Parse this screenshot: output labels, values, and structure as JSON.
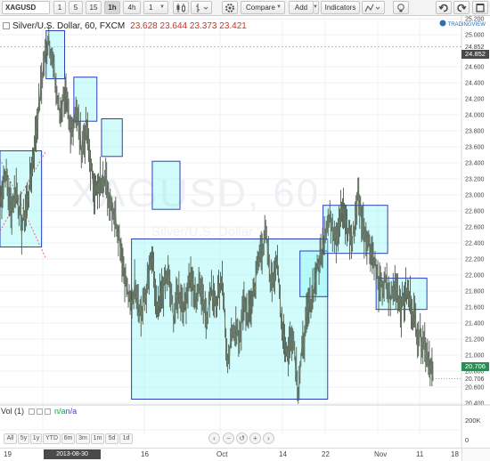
{
  "toolbar": {
    "symbol": "XAGUSD",
    "intervals": [
      "1",
      "5",
      "15",
      "1h",
      "4h",
      "1"
    ],
    "active_interval": "1h",
    "compare_label": "Compare",
    "add_label": "Add",
    "indicators_label": "Indicators"
  },
  "legend": {
    "title": "Silver/U.S. Dollar, 60, FXCM",
    "open": "23.628",
    "high": "23.644",
    "low": "23.373",
    "close": "23.421"
  },
  "watermark": {
    "symbol": "XAGUSD, 60",
    "name": "Silver/U.S. Dollar"
  },
  "price_axis": {
    "labels": [
      "25.200",
      "25.000",
      "24.852",
      "24.600",
      "24.400",
      "24.200",
      "24.000",
      "23.800",
      "23.600",
      "23.400",
      "23.200",
      "23.000",
      "22.800",
      "22.600",
      "22.400",
      "22.200",
      "22.000",
      "21.800",
      "21.600",
      "21.400",
      "21.200",
      "21.000",
      "20.800",
      "20.706",
      "20.600",
      "20.400"
    ],
    "top_badge": "24.852",
    "last_badge": "20.706",
    "last_badge_color": "#2e8b57"
  },
  "volume": {
    "label": "Vol (1)",
    "value1": "n/a",
    "value2": "n/a",
    "axis_labels": [
      "200K",
      "0"
    ]
  },
  "ranges": [
    "All",
    "5y",
    "1y",
    "YTD",
    "6m",
    "3m",
    "1m",
    "5d",
    "1d"
  ],
  "time_axis": {
    "labels": [
      "19",
      "16",
      "Oct",
      "14",
      "22",
      "Nov",
      "11",
      "18"
    ],
    "cursor_time": "2013-08-30 11:00:00"
  },
  "chart_data": {
    "type": "line",
    "title": "Silver/U.S. Dollar, 60, FXCM",
    "xlabel": "",
    "ylabel": "",
    "ylim": [
      20.4,
      25.2
    ],
    "x": [
      "19",
      "16",
      "Oct",
      "14",
      "22",
      "Nov",
      "11",
      "18"
    ],
    "series": [
      {
        "values": [
          22.9,
          23.3,
          22.8,
          23.1,
          22.6,
          22.9,
          23.4,
          24.0,
          24.6,
          25.0,
          24.5,
          24.0,
          24.3,
          23.7,
          24.1,
          23.6,
          23.8,
          23.2,
          23.0,
          23.3,
          23.0,
          22.8,
          22.5,
          22.0,
          21.6,
          21.9,
          21.5,
          21.8,
          22.2,
          21.5,
          21.8,
          22.0,
          21.5,
          21.8,
          21.6,
          22.0,
          21.7,
          21.9,
          21.5,
          21.8,
          21.7,
          22.0,
          20.8,
          21.4,
          21.2,
          21.6,
          21.5,
          21.9,
          22.3,
          22.5,
          21.9,
          22.2,
          21.4,
          21.0,
          21.3,
          20.6,
          21.2,
          21.6,
          21.9,
          22.2,
          22.6,
          22.7,
          22.5,
          22.8,
          22.6,
          22.4,
          23.0,
          22.6,
          22.4,
          22.2,
          21.8,
          21.9,
          21.7,
          21.9,
          21.6,
          21.8,
          21.6,
          21.3,
          21.2,
          21.0,
          20.7
        ]
      }
    ],
    "boxes": [
      {
        "x_start": 0.0,
        "x_end": 0.09,
        "y_low": 22.35,
        "y_high": 23.55
      },
      {
        "x_start": 0.1,
        "x_end": 0.14,
        "y_low": 24.45,
        "y_high": 25.05
      },
      {
        "x_start": 0.16,
        "x_end": 0.21,
        "y_low": 23.92,
        "y_high": 24.47
      },
      {
        "x_start": 0.22,
        "x_end": 0.265,
        "y_low": 23.48,
        "y_high": 23.95
      },
      {
        "x_start": 0.285,
        "x_end": 0.71,
        "y_low": 20.45,
        "y_high": 22.45
      },
      {
        "x_start": 0.33,
        "x_end": 0.39,
        "y_low": 22.82,
        "y_high": 23.42
      },
      {
        "x_start": 0.65,
        "x_end": 0.71,
        "y_low": 21.73,
        "y_high": 22.3
      },
      {
        "x_start": 0.7,
        "x_end": 0.84,
        "y_low": 22.27,
        "y_high": 22.87
      },
      {
        "x_start": 0.815,
        "x_end": 0.925,
        "y_low": 21.57,
        "y_high": 21.96
      }
    ],
    "grid": true
  }
}
